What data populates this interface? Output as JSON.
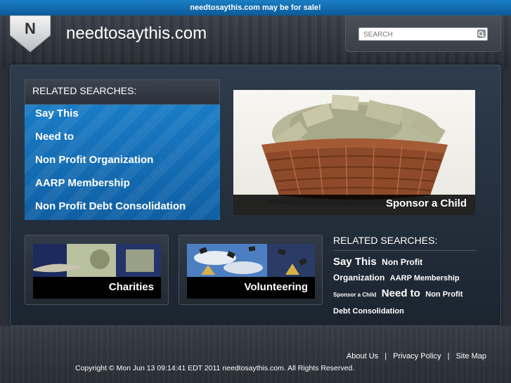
{
  "sale_bar": {
    "text": "needtosaythis.com may be for sale!"
  },
  "header": {
    "logo_letter": "N",
    "site_title": "needtosaythis.com",
    "search_placeholder": "SEARCH"
  },
  "left_panel": {
    "heading": "RELATED SEARCHES:",
    "links": [
      "Say This",
      "Need to",
      "Non Profit Organization",
      "AARP Membership",
      "Non Profit Debt Consolidation"
    ]
  },
  "hero": {
    "caption": "Sponsor a Child"
  },
  "thumbs": [
    {
      "caption": "Charities"
    },
    {
      "caption": "Volunteering"
    }
  ],
  "right_panel": {
    "heading": "RELATED SEARCHES:",
    "tags": [
      {
        "text": "Say This",
        "size": "lg"
      },
      {
        "text": "Non Profit Organization",
        "size": "md"
      },
      {
        "text": "AARP Membership",
        "size": "sm"
      },
      {
        "text": "Sponsor a Child",
        "size": "xs"
      },
      {
        "text": "Need to",
        "size": "lg"
      },
      {
        "text": "Non Profit Debt Consolidation",
        "size": "sm"
      }
    ]
  },
  "footer": {
    "links": [
      "About Us",
      "Privacy Policy",
      "Site Map"
    ],
    "separator": "|",
    "copyright": "Copyright © Mon Jun 13 09:14:41 EDT 2011 needtosaythis.com. All Rights Reserved."
  },
  "colors": {
    "accent_blue": "#1a7cc6",
    "sale_bar_blue": "#0b5a98",
    "panel_dark": "#1b2530"
  }
}
